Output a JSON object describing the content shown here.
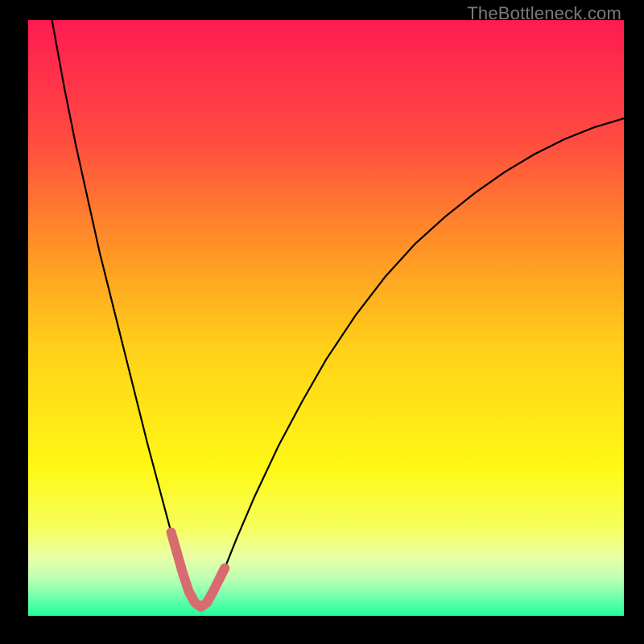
{
  "watermark": "TheBottleneck.com",
  "chart_data": {
    "type": "line",
    "title": "",
    "xlabel": "",
    "ylabel": "",
    "xlim": [
      0,
      100
    ],
    "ylim": [
      0,
      100
    ],
    "grid": false,
    "background": {
      "type": "vertical-gradient",
      "stops": [
        {
          "offset": 0.0,
          "color": "#ff1a52"
        },
        {
          "offset": 0.2,
          "color": "#ff4b40"
        },
        {
          "offset": 0.4,
          "color": "#ff9a24"
        },
        {
          "offset": 0.55,
          "color": "#ffd019"
        },
        {
          "offset": 0.75,
          "color": "#fff814"
        },
        {
          "offset": 0.85,
          "color": "#f6ff5a"
        },
        {
          "offset": 0.9,
          "color": "#eaffa4"
        },
        {
          "offset": 0.94,
          "color": "#b9ffb4"
        },
        {
          "offset": 0.97,
          "color": "#6cffad"
        },
        {
          "offset": 1.0,
          "color": "#1eff9a"
        }
      ]
    },
    "series": [
      {
        "name": "bottleneck-curve",
        "color": "#000000",
        "stroke_width": 2.2,
        "x": [
          4.0,
          6.0,
          8.0,
          10.0,
          12.0,
          14.0,
          16.0,
          18.0,
          20.0,
          22.0,
          24.0,
          25.0,
          26.0,
          27.0,
          28.0,
          29.0,
          30.0,
          31.0,
          33.0,
          35.0,
          38.0,
          42.0,
          46.0,
          50.0,
          55.0,
          60.0,
          65.0,
          70.0,
          75.0,
          80.0,
          85.0,
          90.0,
          95.0,
          100.0
        ],
        "values": [
          100.0,
          89.0,
          79.0,
          70.0,
          61.0,
          53.0,
          45.0,
          37.0,
          29.0,
          21.5,
          14.0,
          10.5,
          7.0,
          4.0,
          2.2,
          1.5,
          2.2,
          4.0,
          8.0,
          13.0,
          20.0,
          28.5,
          36.0,
          43.0,
          50.5,
          57.0,
          62.5,
          67.0,
          71.0,
          74.5,
          77.5,
          80.0,
          82.0,
          83.5
        ]
      },
      {
        "name": "valley-highlight",
        "color": "#d86b6f",
        "stroke_width": 12,
        "linecap": "round",
        "x": [
          24.0,
          25.0,
          26.0,
          27.0,
          28.0,
          29.0,
          30.0,
          31.0,
          32.0,
          33.0
        ],
        "values": [
          14.0,
          10.5,
          7.0,
          4.0,
          2.2,
          1.5,
          2.2,
          4.0,
          6.0,
          8.0
        ]
      }
    ]
  }
}
